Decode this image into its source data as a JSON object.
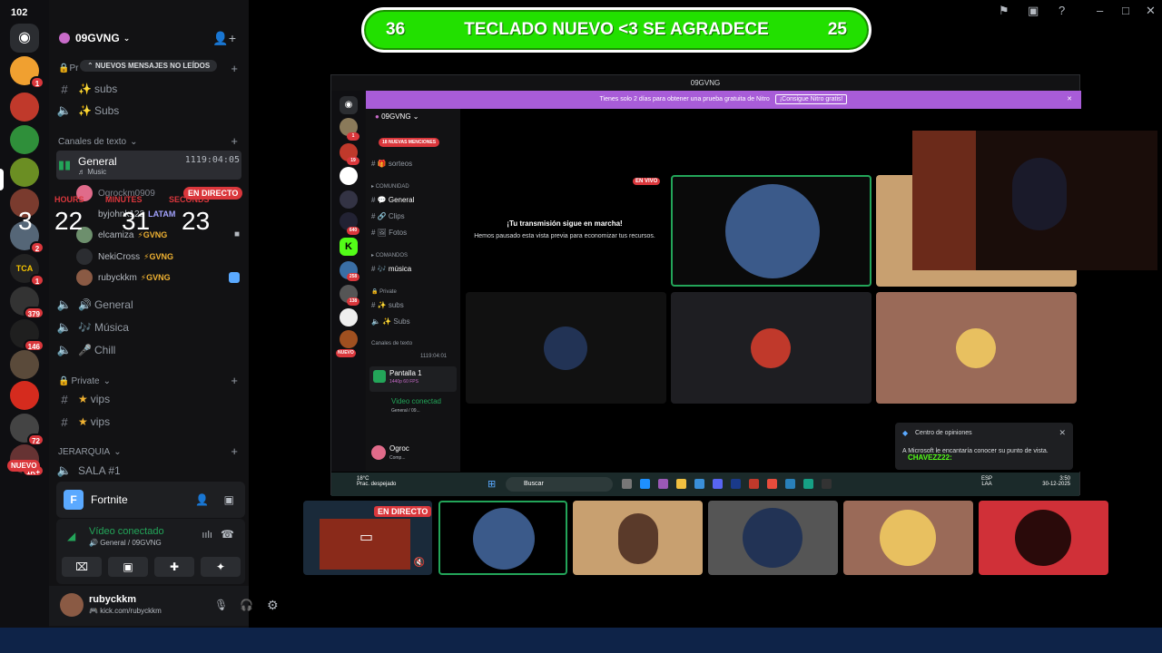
{
  "rail": {
    "count": "102",
    "badges": {
      "s1": "1",
      "s2": "2",
      "s3": "1",
      "s4": "379",
      "s5": "146",
      "s6": "72",
      "s7": "1K+"
    },
    "nuevo": "NUEVO"
  },
  "sidebar": {
    "guild_name": "09GVNG",
    "unread_pill": "NUEVOS MENSAJES NO LEÍDOS",
    "private_cat_partial": "Pr",
    "rows": {
      "subs_text": "subs",
      "subs_voice": "Subs",
      "general_ch": "General",
      "general_sub": "Music",
      "general_time": "1119:04:05",
      "general1": "General",
      "musica": "Música",
      "chill": "Chill",
      "vips_text": "vips",
      "vips_voice": "vips",
      "sala1": "SALA #1"
    },
    "categories": {
      "text": "Canales de texto",
      "private": "Private",
      "jerarquia": "JERARQUIA"
    },
    "voice_users": [
      {
        "name": "Ogrockm0909",
        "tag": ""
      },
      {
        "name": "byjohnk122",
        "tag": "LATAM"
      },
      {
        "name": "elcamiza",
        "tag": "GVNG"
      },
      {
        "name": "NekiCross",
        "tag": "GVNG"
      },
      {
        "name": "rubyckkm",
        "tag": "GVNG"
      }
    ],
    "live_tag": "EN DIRECTO",
    "timer": {
      "hours_label": "HOURS",
      "minutes_label": "MINUTES",
      "seconds_label": "SECONDS",
      "d": "3",
      "h": "22",
      "m": "31",
      "s": "23"
    },
    "game": "Fortnite",
    "connection": {
      "title": "Vídeo conectado",
      "sub": "General / 09GVNG"
    },
    "user": {
      "name": "rubyckkm",
      "sub": "kick.com/rubyckkm"
    }
  },
  "banner": {
    "left": "36",
    "text": "TECLADO NUEVO <3 SE AGRADECE",
    "right": "25"
  },
  "inner": {
    "title": "09GVNG",
    "nitro_text": "Tienes solo 2 días para obtener una prueba gratuita de Nitro",
    "nitro_cta": "¡Consigue Nitro gratis!",
    "guild": "09GVNG",
    "mentions": "18 NUEVAS MENCIONES",
    "rail_badges": {
      "b1": "1",
      "b2": "19",
      "b3": "640",
      "b4": "258",
      "b5": "138",
      "b6": "NUEVO"
    },
    "channels": {
      "sorteos": "sorteos",
      "comunidad": "COMUNIDAD",
      "general": "General",
      "clips": "Clips",
      "fotos": "Fotos",
      "comandos": "COMANDOS",
      "musica": "música",
      "private": "Private",
      "subs": "subs",
      "subs2": "Subs",
      "texto": "Canales de texto",
      "time": "1119:04:01"
    },
    "stream": {
      "title": "Pantalla 1",
      "sub": "1440p 60 FPS"
    },
    "conn": {
      "title": "Video conectad",
      "sub": "General / 09..."
    },
    "user": {
      "name": "Ogroc",
      "sub": "Comp..."
    },
    "live": "EN VIVO",
    "msg_title": "¡Tu transmisión sigue en marcha!",
    "msg_body": "Hemos pausado esta vista previa para economizar tus recursos.",
    "feedback_title": "Centro de opiniones",
    "feedback_body": "A Microsoft le encantaría conocer su punto de vista.",
    "chat_overlay": "CHAVEZZ22:",
    "taskbar": {
      "temp": "18°C",
      "weather": "Prac. despejado",
      "search": "Buscar",
      "lang1": "ESP",
      "lang2": "LAA",
      "time": "3:50",
      "date": "30-12-2025"
    }
  },
  "strip": {
    "live": "EN DIRECTO"
  },
  "colors": {
    "accent": "#22e000",
    "live": "#da373c",
    "connected": "#23a559",
    "nitro": "#a85cd8"
  }
}
